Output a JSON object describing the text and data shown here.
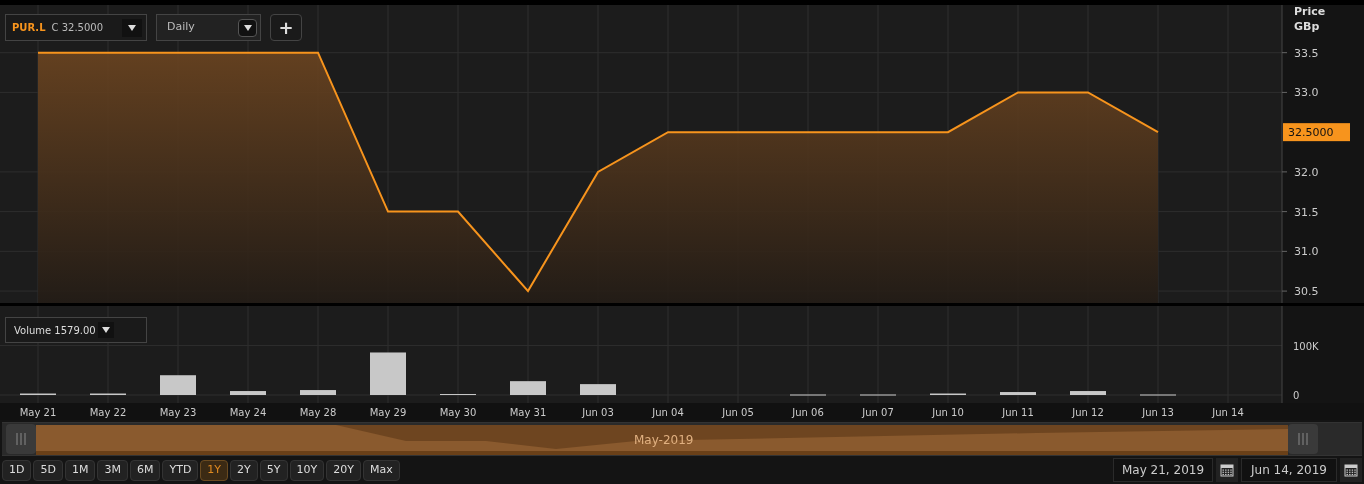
{
  "toolbar": {
    "symbol": "PUR.L",
    "quote": "C 32.5000",
    "interval": "Daily",
    "add_label": "+"
  },
  "price_chart": {
    "last_price": "32.5000",
    "chart_data": {
      "type": "area",
      "ylabel": "Price GBp",
      "grid": true,
      "ylim": [
        30.35,
        34.1
      ],
      "series": [
        {
          "color": "#f7941d",
          "values": [
            33.5,
            33.5,
            33.5,
            33.5,
            33.5,
            31.5,
            31.5,
            30.5,
            32.0,
            32.5,
            32.5,
            32.5,
            32.5,
            32.5,
            33.0,
            33.0,
            32.5,
            null
          ]
        }
      ],
      "yticks": [
        {
          "value": 33.5,
          "label": "33.5"
        },
        {
          "value": 33.0,
          "label": "33.0"
        },
        {
          "value": 32.0,
          "label": "32.0"
        },
        {
          "value": 31.5,
          "label": "31.5"
        },
        {
          "value": 31.0,
          "label": "31.0"
        },
        {
          "value": 30.5,
          "label": "30.5"
        }
      ]
    }
  },
  "volume_chart": {
    "legend": "Volume 1579.00",
    "chart_data": {
      "type": "bar",
      "grid": true,
      "ylim": [
        0,
        180000
      ],
      "categories": [
        "May 21",
        "May 22",
        "May 23",
        "May 24",
        "May 28",
        "May 29",
        "May 30",
        "May 31",
        "Jun 03",
        "Jun 04",
        "Jun 05",
        "Jun 06",
        "Jun 07",
        "Jun 10",
        "Jun 11",
        "Jun 12",
        "Jun 13",
        "Jun 14"
      ],
      "series": [
        {
          "color": "#c8c8c8",
          "values": [
            3000,
            3000,
            40000,
            8000,
            10000,
            86000,
            2000,
            28000,
            22000,
            null,
            null,
            1000,
            1000,
            3000,
            6000,
            8000,
            1000,
            null
          ]
        }
      ],
      "yticks": [
        {
          "value": 0,
          "label": "0"
        },
        {
          "value": 100000,
          "label": "100K"
        }
      ]
    }
  },
  "navigator": {
    "label": "May-2019"
  },
  "ranges": [
    {
      "label": "1D",
      "selected": false
    },
    {
      "label": "5D",
      "selected": false
    },
    {
      "label": "1M",
      "selected": false
    },
    {
      "label": "3M",
      "selected": false
    },
    {
      "label": "6M",
      "selected": false
    },
    {
      "label": "YTD",
      "selected": false
    },
    {
      "label": "1Y",
      "selected": true
    },
    {
      "label": "2Y",
      "selected": false
    },
    {
      "label": "5Y",
      "selected": false
    },
    {
      "label": "10Y",
      "selected": false
    },
    {
      "label": "20Y",
      "selected": false
    },
    {
      "label": "Max",
      "selected": false
    }
  ],
  "date_range": {
    "start": "May 21, 2019",
    "end": "Jun 14, 2019"
  }
}
